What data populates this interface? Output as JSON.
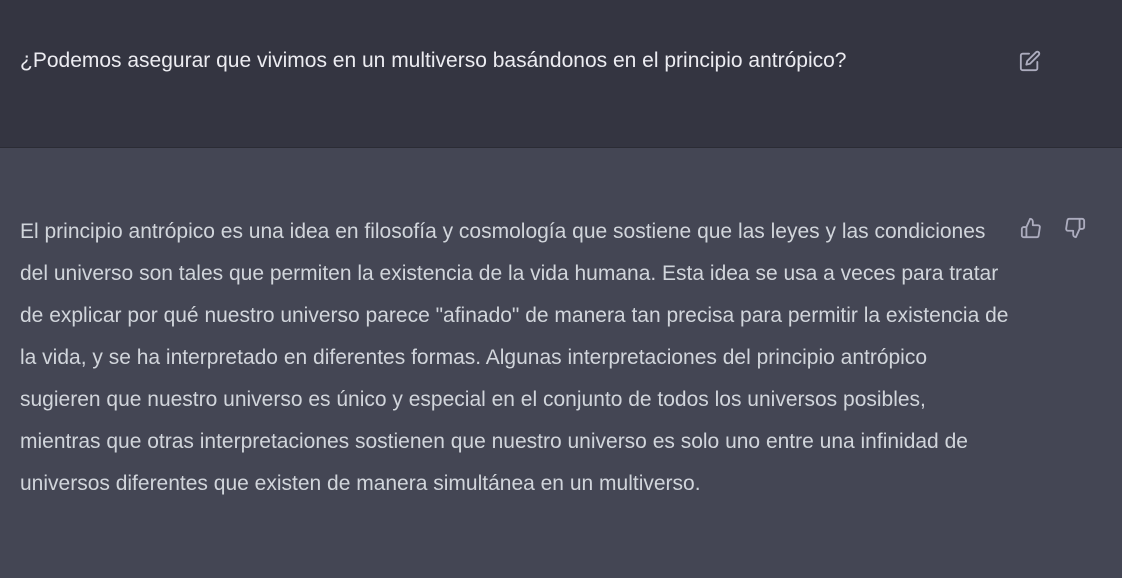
{
  "user_message": {
    "text": "¿Podemos asegurar que vivimos en un multiverso basándonos en el principio antrópico?",
    "edit_icon": "edit-icon"
  },
  "assistant_message": {
    "text": "El principio antrópico es una idea en filosofía y cosmología que sostiene que las leyes y las condiciones del universo son tales que permiten la existencia de la vida humana. Esta idea se usa a veces para tratar de explicar por qué nuestro universo parece \"afinado\" de manera tan precisa para permitir la existencia de la vida, y se ha interpretado en diferentes formas. Algunas interpretaciones del principio antrópico sugieren que nuestro universo es único y especial en el conjunto de todos los universos posibles, mientras que otras interpretaciones sostienen que nuestro universo es solo uno entre una infinidad de universos diferentes que existen de manera simultánea en un multiverso.",
    "feedback_icons": [
      "thumbs-up-icon",
      "thumbs-down-icon"
    ]
  },
  "colors": {
    "user_bg": "#343541",
    "assistant_bg": "#444654",
    "user_text": "#ececf1",
    "assistant_text": "#d1d5db",
    "icon": "#acacbe"
  }
}
